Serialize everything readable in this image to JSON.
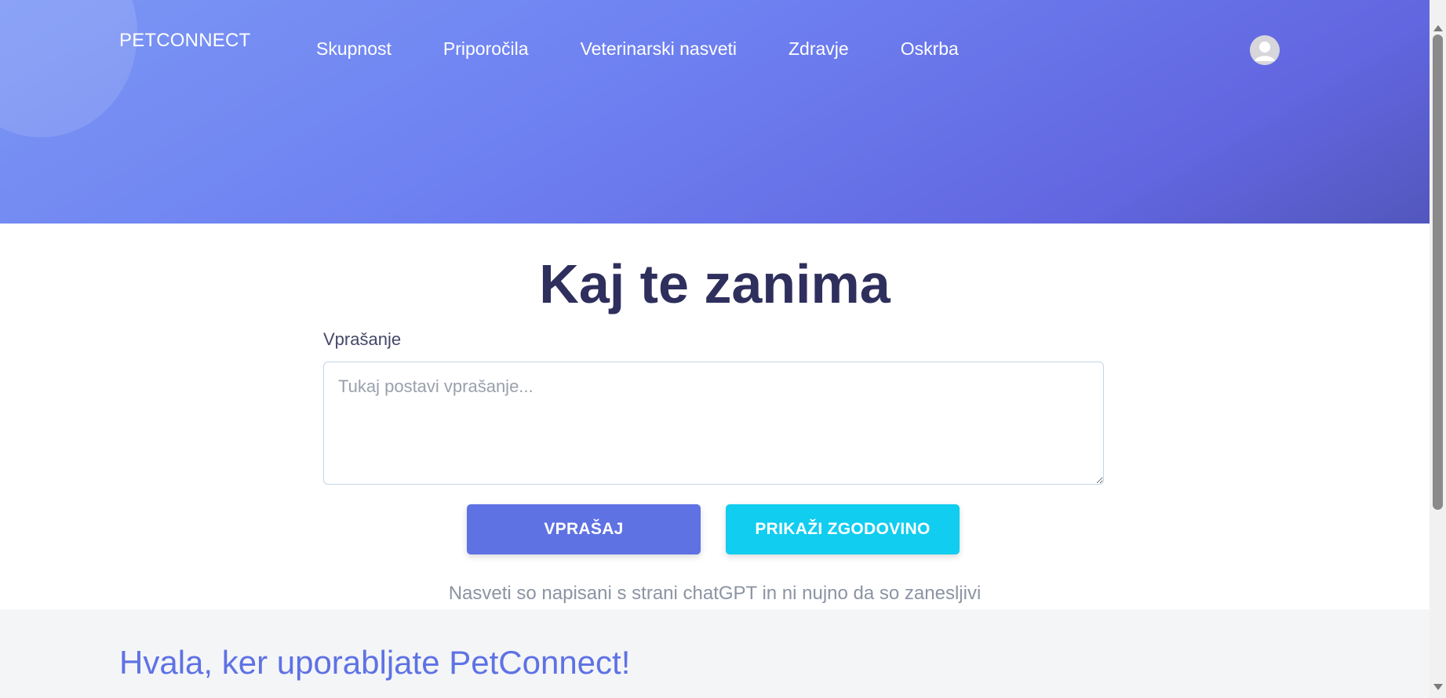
{
  "header": {
    "brand": "PETCONNECT",
    "nav": [
      "Skupnost",
      "Priporočila",
      "Veterinarski nasveti",
      "Zdravje",
      "Oskrba"
    ],
    "avatar_icon": "user-avatar-icon"
  },
  "main": {
    "title": "Kaj te zanima",
    "question_label": "Vprašanje",
    "question_placeholder": "Tukaj postavi vprašanje...",
    "ask_button": "VPRAŠAJ",
    "history_button": "PRIKAŽI ZGODOVINO",
    "disclaimer": "Nasveti so napisani s strani chatGPT in ni nujno da so zanesljivi"
  },
  "footer": {
    "thanks": "Hvala, ker uporabljate PetConnect!"
  },
  "colors": {
    "primary": "#5e72e4",
    "info": "#11cdef",
    "heading": "#2e2f5d"
  }
}
